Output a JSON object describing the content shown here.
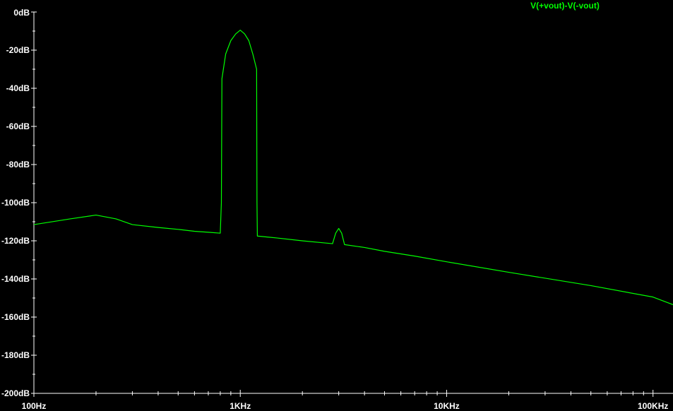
{
  "chart_data": {
    "type": "line",
    "title": "",
    "xlabel": "",
    "ylabel": "",
    "x_scale": "log",
    "xlim": [
      100,
      125000
    ],
    "ylim": [
      -200,
      0
    ],
    "grid": false,
    "background": "#000000",
    "axis_color": "#ffffff",
    "x_ticks": [
      {
        "value": 100,
        "label": "100Hz"
      },
      {
        "value": 1000,
        "label": "1KHz"
      },
      {
        "value": 10000,
        "label": "10KHz"
      },
      {
        "value": 100000,
        "label": "100KHz"
      }
    ],
    "y_ticks": [
      {
        "value": 0,
        "label": "0dB"
      },
      {
        "value": -20,
        "label": "-20dB"
      },
      {
        "value": -40,
        "label": "-40dB"
      },
      {
        "value": -60,
        "label": "-60dB"
      },
      {
        "value": -80,
        "label": "-80dB"
      },
      {
        "value": -100,
        "label": "-100dB"
      },
      {
        "value": -120,
        "label": "-120dB"
      },
      {
        "value": -140,
        "label": "-140dB"
      },
      {
        "value": -160,
        "label": "-160dB"
      },
      {
        "value": -180,
        "label": "-180dB"
      },
      {
        "value": -200,
        "label": "-200dB"
      }
    ],
    "legend_position": "top-right",
    "series": [
      {
        "name": "V(+vout)-V(-vout)",
        "color": "#00ff00",
        "points": [
          [
            100,
            -111.5
          ],
          [
            150,
            -108.5
          ],
          [
            200,
            -106.5
          ],
          [
            250,
            -108.5
          ],
          [
            300,
            -111.5
          ],
          [
            400,
            -113
          ],
          [
            500,
            -114
          ],
          [
            600,
            -115
          ],
          [
            700,
            -115.5
          ],
          [
            800,
            -116
          ],
          [
            810,
            -100
          ],
          [
            815,
            -35
          ],
          [
            850,
            -22
          ],
          [
            900,
            -15
          ],
          [
            950,
            -11.5
          ],
          [
            1000,
            -9.5
          ],
          [
            1050,
            -11.5
          ],
          [
            1100,
            -15
          ],
          [
            1150,
            -22
          ],
          [
            1200,
            -30
          ],
          [
            1205,
            -100
          ],
          [
            1210,
            -117.5
          ],
          [
            1500,
            -118.5
          ],
          [
            2000,
            -120
          ],
          [
            2500,
            -121
          ],
          [
            2800,
            -121.5
          ],
          [
            2900,
            -116
          ],
          [
            3000,
            -113.5
          ],
          [
            3100,
            -116
          ],
          [
            3200,
            -122
          ],
          [
            4000,
            -123.5
          ],
          [
            5000,
            -125.5
          ],
          [
            7000,
            -128
          ],
          [
            10000,
            -131
          ],
          [
            20000,
            -136.5
          ],
          [
            50000,
            -143.5
          ],
          [
            100000,
            -149.5
          ],
          [
            125000,
            -153.5
          ]
        ]
      }
    ]
  }
}
